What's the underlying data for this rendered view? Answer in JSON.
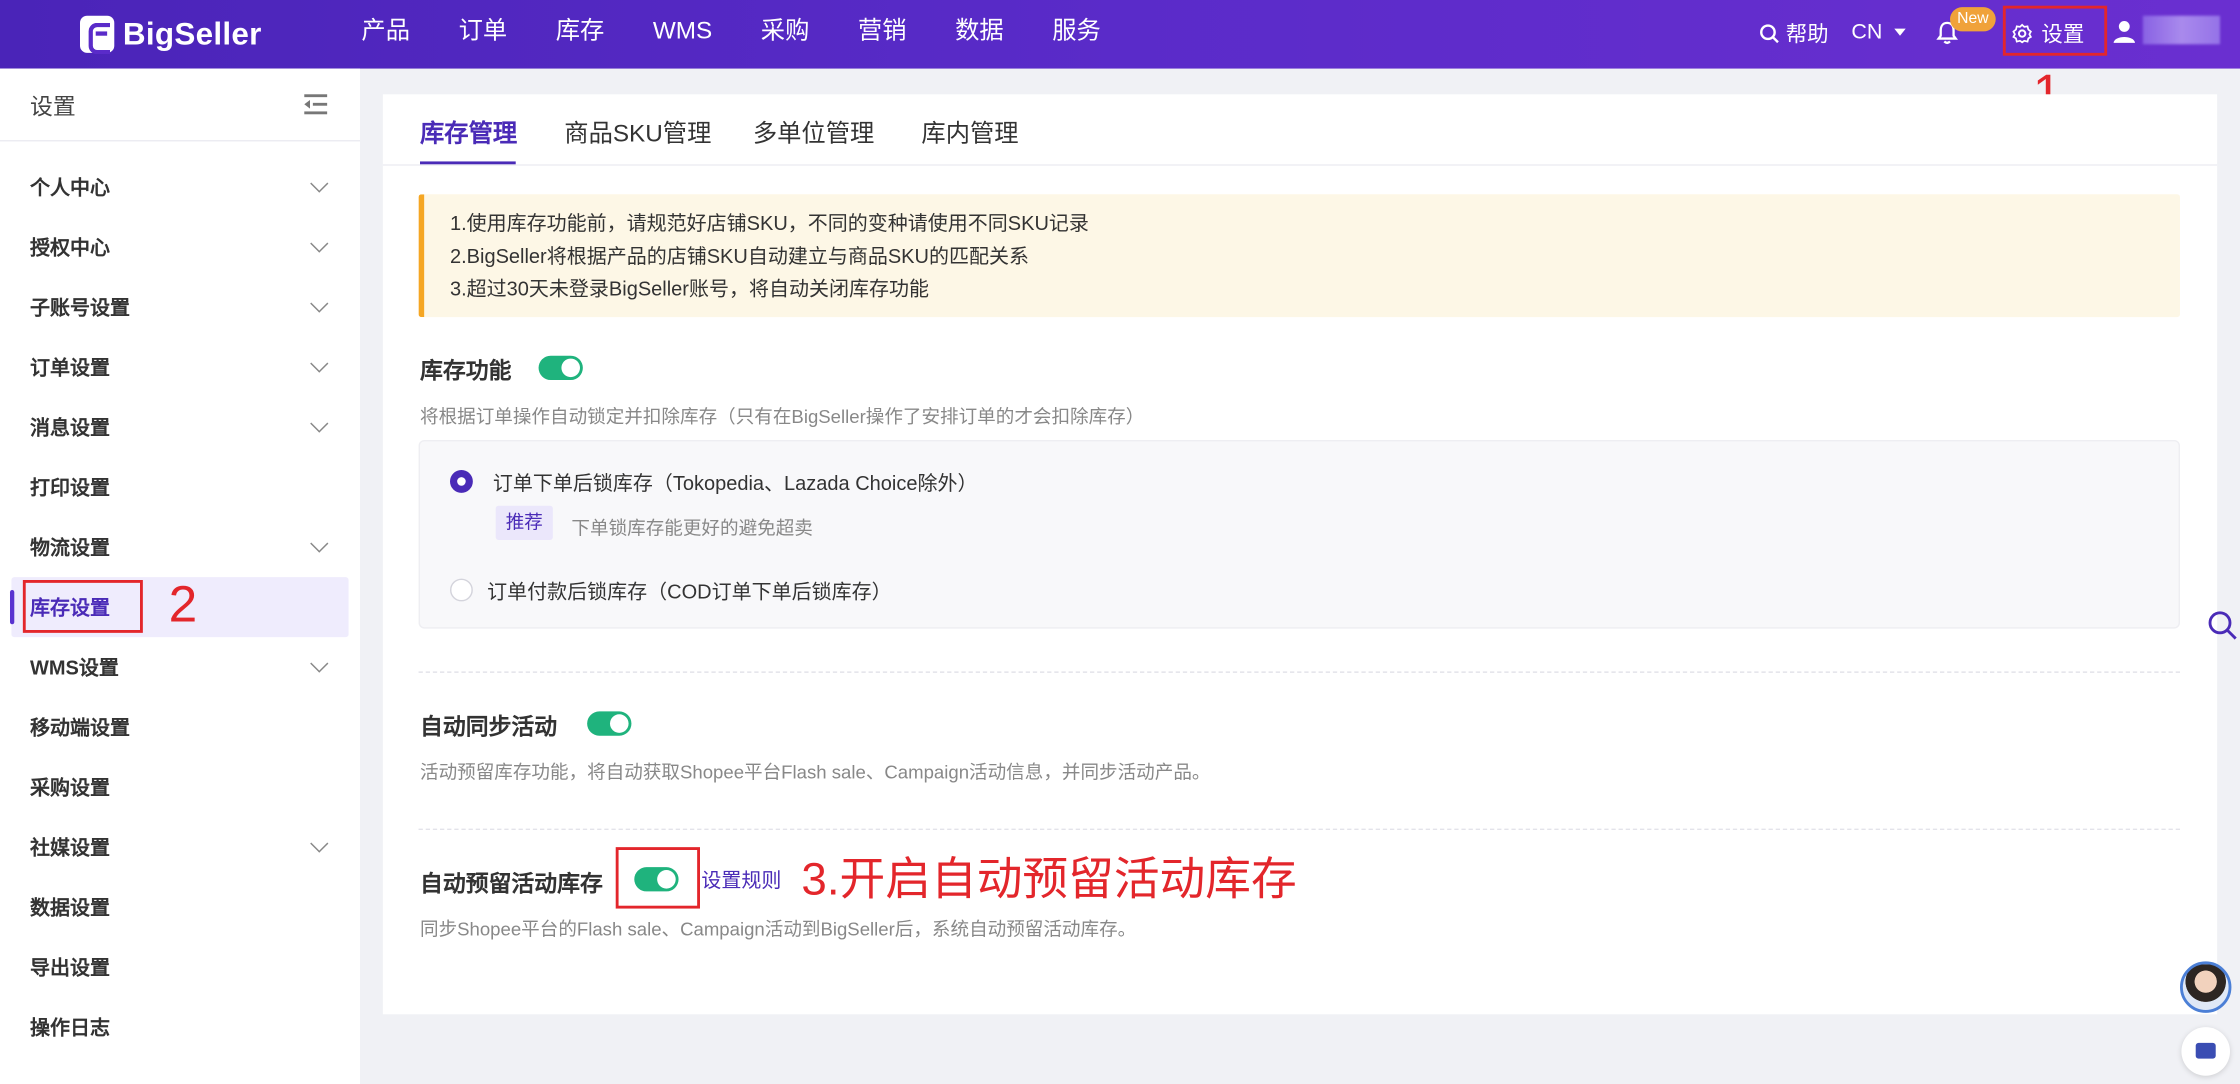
{
  "brand": {
    "name": "BigSeller"
  },
  "header": {
    "nav": [
      "产品",
      "订单",
      "库存",
      "WMS",
      "采购",
      "营销",
      "数据",
      "服务"
    ],
    "help_label": "帮助",
    "lang_label": "CN",
    "new_badge": "New",
    "settings_label": "设置",
    "accent_color": "#5a2bc9"
  },
  "sidebar": {
    "title": "设置",
    "items": [
      {
        "label": "个人中心",
        "expandable": true
      },
      {
        "label": "授权中心",
        "expandable": true
      },
      {
        "label": "子账号设置",
        "expandable": true
      },
      {
        "label": "订单设置",
        "expandable": true
      },
      {
        "label": "消息设置",
        "expandable": true
      },
      {
        "label": "打印设置",
        "expandable": false
      },
      {
        "label": "物流设置",
        "expandable": true
      },
      {
        "label": "库存设置",
        "expandable": false,
        "active": true
      },
      {
        "label": "WMS设置",
        "expandable": true
      },
      {
        "label": "移动端设置",
        "expandable": false
      },
      {
        "label": "采购设置",
        "expandable": false
      },
      {
        "label": "社媒设置",
        "expandable": true
      },
      {
        "label": "数据设置",
        "expandable": false
      },
      {
        "label": "导出设置",
        "expandable": false
      },
      {
        "label": "操作日志",
        "expandable": false
      }
    ]
  },
  "tabs": [
    "库存管理",
    "商品SKU管理",
    "多单位管理",
    "库内管理"
  ],
  "notice": [
    "1.使用库存功能前，请规范好店铺SKU，不同的变种请使用不同SKU记录",
    "2.BigSeller将根据产品的店铺SKU自动建立与商品SKU的匹配关系",
    "3.超过30天未登录BigSeller账号，将自动关闭库存功能"
  ],
  "inventory": {
    "title": "库存功能",
    "enabled": true,
    "desc": "将根据订单操作自动锁定并扣除库存（只有在BigSeller操作了安排订单的才会扣除库存）",
    "option1": "订单下单后锁库存（Tokopedia、Lazada Choice除外）",
    "recommend_tag": "推荐",
    "recommend_desc": "下单锁库存能更好的避免超卖",
    "option2": "订单付款后锁库存（COD订单下单后锁库存）",
    "selected_option": 1
  },
  "sync": {
    "title": "自动同步活动",
    "enabled": true,
    "desc": "活动预留库存功能，将自动获取Shopee平台Flash sale、Campaign活动信息，并同步活动产品。"
  },
  "reserve": {
    "title": "自动预留活动库存",
    "enabled": true,
    "rule_link": "设置规则",
    "desc": "同步Shopee平台的Flash sale、Campaign活动到BigSeller后，系统自动预留活动库存。"
  },
  "annotations": {
    "step1": "1",
    "step2": "2",
    "step3": "3.开启自动预留活动库存"
  }
}
